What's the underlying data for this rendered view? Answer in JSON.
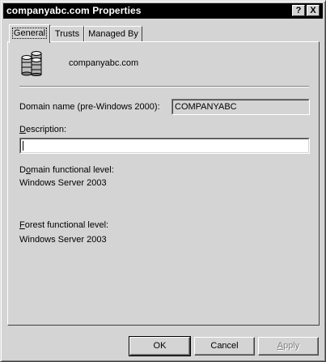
{
  "window": {
    "title": "companyabc.com Properties",
    "help_button": "?",
    "close_button": "X"
  },
  "tabs": [
    {
      "label": "General",
      "selected": true
    },
    {
      "label": "Trusts",
      "selected": false
    },
    {
      "label": "Managed By",
      "selected": false
    }
  ],
  "general": {
    "domain_icon": "domain-servers-icon",
    "domain_name": "companyabc.com",
    "prewin2000_label": "Domain name (pre-Windows 2000):",
    "prewin2000_value": "COMPANYABC",
    "description_label_mnemonic": "D",
    "description_label_rest": "escription:",
    "description_value": "",
    "domain_level_label_prefix": "D",
    "domain_level_label_mnemonic": "o",
    "domain_level_label_rest": "main functional level:",
    "domain_level_value": "Windows Server 2003",
    "forest_level_label_mnemonic": "F",
    "forest_level_label_rest": "orest functional level:",
    "forest_level_value": "Windows Server 2003"
  },
  "buttons": {
    "ok": "OK",
    "cancel": "Cancel",
    "apply_mnemonic": "A",
    "apply_rest": "pply"
  },
  "colors": {
    "face": "#d4d4d4",
    "titlebar": "#000000",
    "shadow": "#808080",
    "highlight": "#ffffff"
  }
}
